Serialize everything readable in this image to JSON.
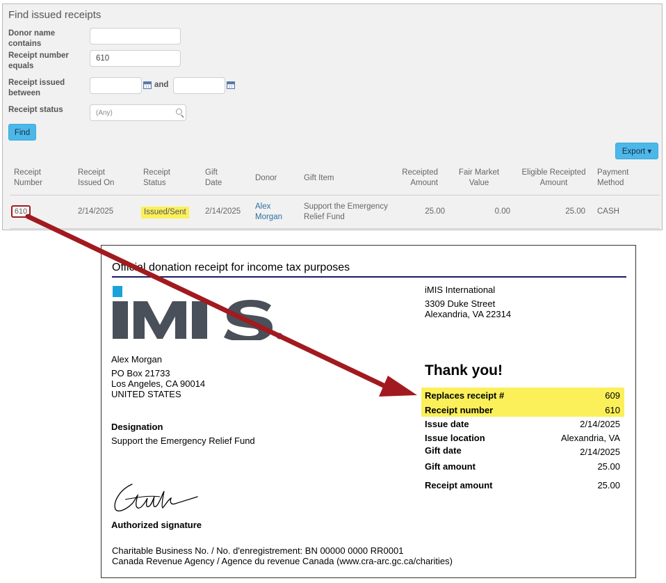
{
  "search_panel": {
    "title": "Find issued receipts",
    "fields": {
      "donor_name_label": "Donor name contains",
      "donor_name_value": "",
      "receipt_number_label": "Receipt number equals",
      "receipt_number_value": "610",
      "issued_between_label": "Receipt issued between",
      "issued_from_value": "",
      "issued_and_label": "and",
      "issued_to_value": "",
      "status_label": "Receipt status",
      "status_value": "(Any)"
    },
    "find_button": "Find",
    "export_button": "Export ▾",
    "table": {
      "headers": {
        "receipt_number": "Receipt Number",
        "issued_on": "Receipt Issued On",
        "status": "Receipt Status",
        "gift_date": "Gift Date",
        "donor": "Donor",
        "gift_item": "Gift Item",
        "receipted_amount": "Receipted Amount",
        "fair_market_value": "Fair Market Value",
        "eligible_amount": "Eligible Receipted Amount",
        "payment_method": "Payment Method"
      },
      "rows": [
        {
          "receipt_number": "610",
          "issued_on": "2/14/2025",
          "status": "Issued/Sent",
          "gift_date": "2/14/2025",
          "donor": "Alex Morgan",
          "gift_item": "Support the Emergency Relief Fund",
          "receipted_amount": "25.00",
          "fair_market_value": "0.00",
          "eligible_amount": "25.00",
          "payment_method": "CASH"
        }
      ]
    }
  },
  "receipt": {
    "title": "Official donation receipt for income tax purposes",
    "logo_text": "iMIS",
    "org": {
      "name": "iMIS International",
      "street": "3309 Duke Street",
      "city": "Alexandria, VA 22314"
    },
    "donor": {
      "name": "Alex Morgan",
      "street": "PO Box 21733",
      "city": "Los Angeles, CA  90014",
      "country": "UNITED STATES"
    },
    "designation_label": "Designation",
    "designation_value": "Support the Emergency Relief Fund",
    "thank_you": "Thank you!",
    "details": {
      "replaces_label": "Replaces receipt #",
      "replaces_value": "609",
      "receipt_number_label": "Receipt number",
      "receipt_number_value": "610",
      "issue_date_label": "Issue date",
      "issue_date_value": "2/14/2025",
      "issue_location_label": "Issue location",
      "issue_location_value": "Alexandria, VA",
      "gift_date_label": "Gift date",
      "gift_date_value": "2/14/2025",
      "gift_amount_label": "Gift amount",
      "gift_amount_value": "25.00",
      "receipt_amount_label": "Receipt amount",
      "receipt_amount_value": "25.00"
    },
    "signature_label": "Authorized signature",
    "footer_line1": "Charitable Business No. / No. d'enregistrement: BN 00000 0000 RR0001",
    "footer_line2": "Canada Revenue Agency / Agence du revenue Canada (www.cra-arc.gc.ca/charities)"
  },
  "colors": {
    "highlight": "#fbf05a",
    "arrow": "#a11a1f",
    "button": "#4cb8ea",
    "logo_dark": "#4a5059",
    "logo_accent": "#1aa3d9",
    "rule": "#1a1a66"
  }
}
